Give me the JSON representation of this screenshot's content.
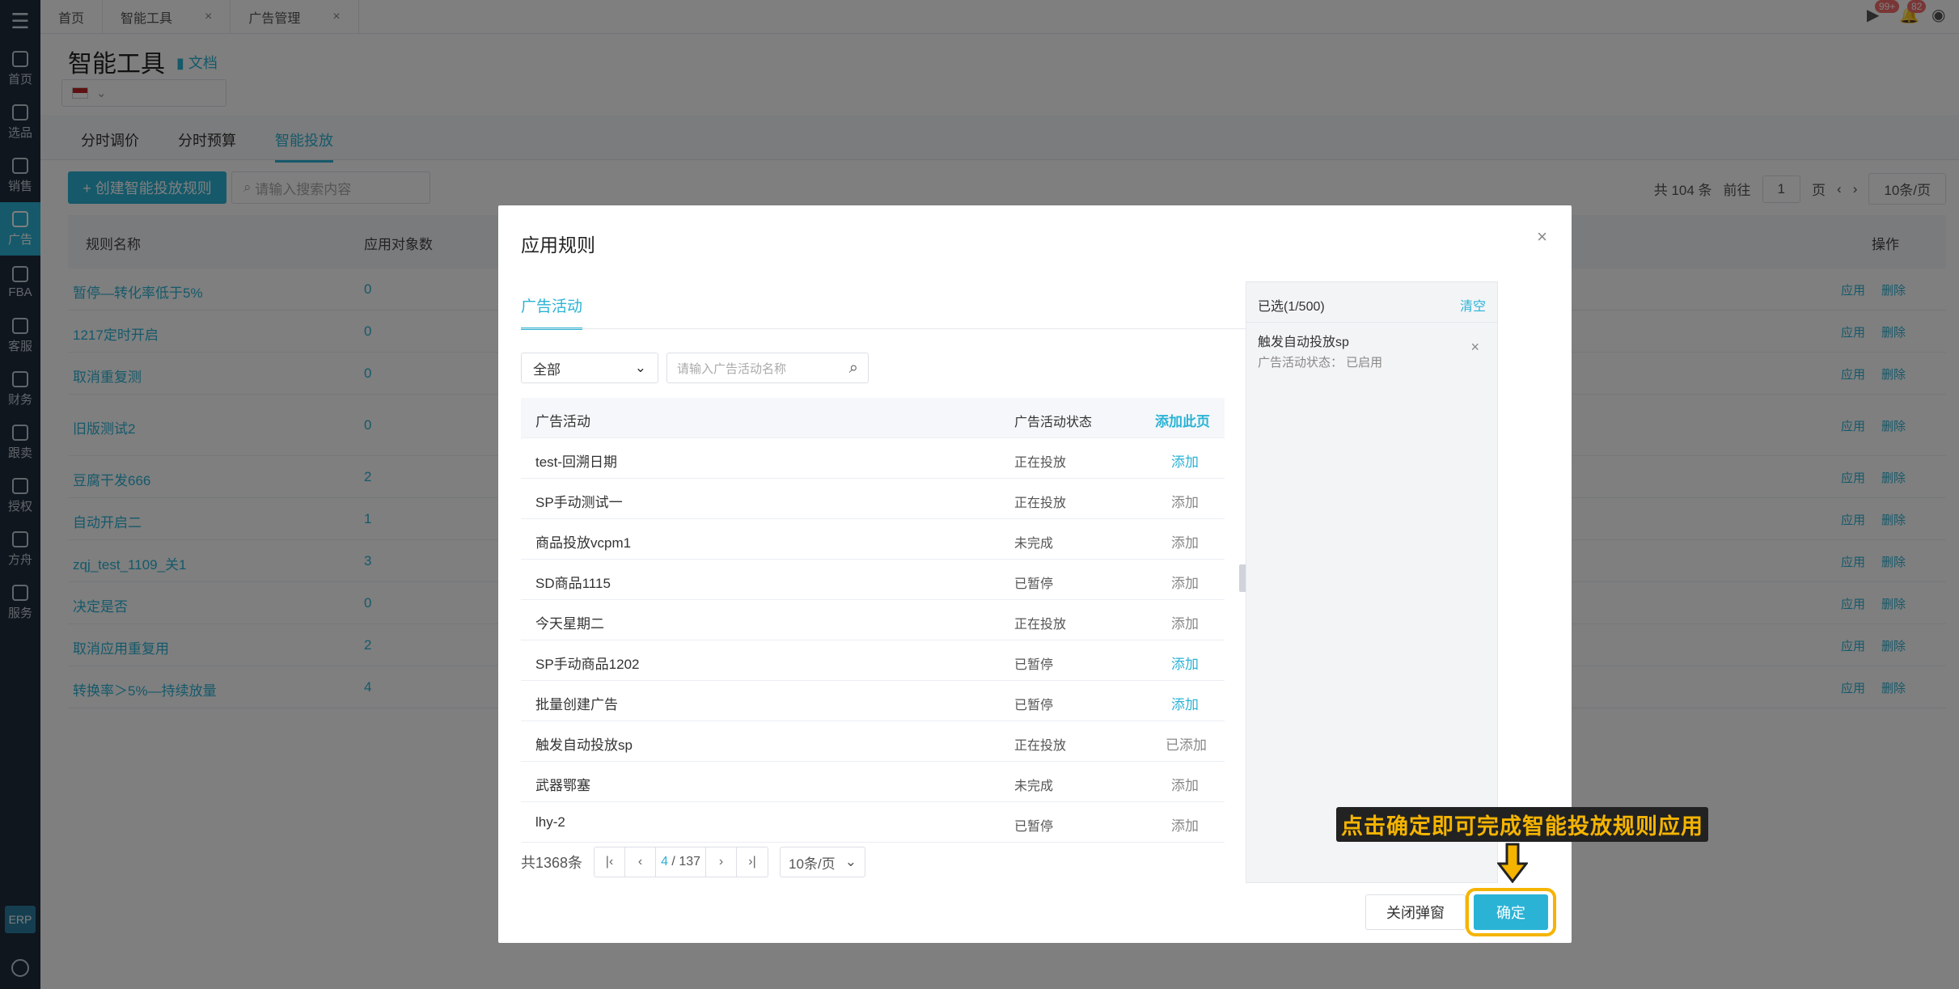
{
  "window_tabs": [
    {
      "label": "首页"
    },
    {
      "label": "智能工具",
      "close": "×"
    },
    {
      "label": "广告管理",
      "close": "×"
    }
  ],
  "top_badges": {
    "play": "99+",
    "bell": "82"
  },
  "sidebar": {
    "items": [
      {
        "label": "首页"
      },
      {
        "label": "选品"
      },
      {
        "label": "销售"
      },
      {
        "label": "广告"
      },
      {
        "label": "FBA"
      },
      {
        "label": "客服"
      },
      {
        "label": "财务"
      },
      {
        "label": "跟卖"
      },
      {
        "label": "授权"
      },
      {
        "label": "方舟"
      },
      {
        "label": "服务"
      }
    ],
    "erp": "ERP"
  },
  "page": {
    "title": "智能工具",
    "doc_link": "文档",
    "subtabs": [
      "分时调价",
      "分时预算",
      "智能投放"
    ],
    "create_button": "+ 创建智能投放规则",
    "search_placeholder": "请输入搜索内容",
    "pager": {
      "total": "共 104 条",
      "goto": "前往",
      "page": "1",
      "page_unit": "页",
      "size": "10条/页"
    },
    "columns": {
      "name": "规则名称",
      "count": "应用对象数",
      "actions": "操作"
    },
    "rows": [
      {
        "name": "暂停—转化率低于5%",
        "count": "0"
      },
      {
        "name": "1217定时开启",
        "count": "0"
      },
      {
        "name": "取消重复测",
        "count": "0"
      },
      {
        "name": "旧版测试2",
        "count": "0"
      },
      {
        "name": "豆腐干发666",
        "count": "2"
      },
      {
        "name": "自动开启二",
        "count": "1"
      },
      {
        "name": "zqj_test_1109_关1",
        "count": "3"
      },
      {
        "name": "决定是否",
        "count": "0"
      },
      {
        "name": "取消应用重复用",
        "count": "2"
      },
      {
        "name": "转换率＞5%—持续放量",
        "count": "4"
      }
    ],
    "row_actions": {
      "apply": "应用",
      "delete": "删除"
    }
  },
  "modal": {
    "title": "应用规则",
    "tab": "广告活动",
    "filter_select": "全部",
    "search_placeholder": "请输入广告活动名称",
    "columns": {
      "campaign": "广告活动",
      "status": "广告活动状态",
      "add_page": "添加此页"
    },
    "rows": [
      {
        "name": "test-回溯日期",
        "status": "正在投放",
        "action": "添加",
        "action_style": "link"
      },
      {
        "name": "SP手动测试一",
        "status": "正在投放",
        "action": "添加",
        "action_style": "muted"
      },
      {
        "name": "商品投放vcpm1",
        "status": "未完成",
        "action": "添加",
        "action_style": "muted"
      },
      {
        "name": "SD商品1115",
        "status": "已暂停",
        "action": "添加",
        "action_style": "muted"
      },
      {
        "name": "今天星期二",
        "status": "正在投放",
        "action": "添加",
        "action_style": "muted"
      },
      {
        "name": "SP手动商品1202",
        "status": "已暂停",
        "action": "添加",
        "action_style": "link"
      },
      {
        "name": "批量创建广告",
        "status": "已暂停",
        "action": "添加",
        "action_style": "link"
      },
      {
        "name": "触发自动投放sp",
        "status": "正在投放",
        "action": "已添加",
        "action_style": "muted"
      },
      {
        "name": "武器鄂塞",
        "status": "未完成",
        "action": "添加",
        "action_style": "muted"
      },
      {
        "name": "lhy-2",
        "status": "已暂停",
        "action": "添加",
        "action_style": "muted"
      }
    ],
    "pager": {
      "total": "共1368条",
      "current": "4",
      "sep": "/ 137",
      "size": "10条/页"
    },
    "selected": {
      "count": "已选(1/500)",
      "clear": "清空",
      "items": [
        {
          "name": "触发自动投放sp",
          "status": "广告活动状态：  已启用"
        }
      ]
    },
    "close_button": "关闭弹窗",
    "confirm_button": "确定"
  },
  "callout": "点击确定即可完成智能投放规则应用",
  "colors": {
    "accent": "#2bb3d5",
    "highlight": "#f5b400"
  }
}
